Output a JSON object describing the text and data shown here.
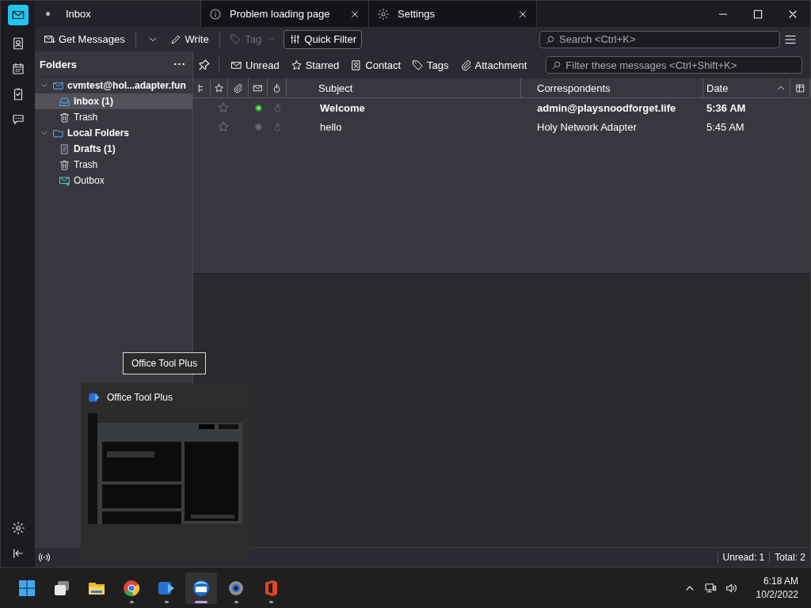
{
  "tabs": [
    {
      "label": "Inbox",
      "kind": "mail",
      "selected": true
    },
    {
      "label": "Problem loading page",
      "kind": "info",
      "selected": false
    },
    {
      "label": "Settings",
      "kind": "gear",
      "selected": false
    }
  ],
  "toolbar": {
    "buttons": [
      {
        "label": "Get Messages",
        "kind": "get",
        "disabled": false
      },
      {
        "label": "Write",
        "kind": "write",
        "disabled": false
      },
      {
        "label": "Tag",
        "kind": "tag",
        "disabled": true
      },
      {
        "label": "Quick Filter",
        "kind": "filter",
        "disabled": false
      }
    ],
    "search": {
      "placeholder": "Search <Ctrl+K>"
    }
  },
  "folders": {
    "title": "Folders",
    "tree": [
      {
        "label": "cvmtest@hol...adapter.fun",
        "kind": "account",
        "expanded": true,
        "selected": false,
        "children": [
          {
            "label": "Inbox (1)",
            "kind": "inbox",
            "selected": true,
            "unread": true
          },
          {
            "label": "Trash",
            "kind": "trash",
            "selected": false,
            "unread": false
          }
        ]
      },
      {
        "label": "Local Folders",
        "kind": "local",
        "expanded": true,
        "selected": false,
        "children": [
          {
            "label": "Drafts (1)",
            "kind": "drafts",
            "selected": false,
            "unread": true
          },
          {
            "label": "Trash",
            "kind": "trash",
            "selected": false,
            "unread": false
          },
          {
            "label": "Outbox",
            "kind": "outbox",
            "selected": false,
            "unread": false
          }
        ]
      }
    ]
  },
  "quick_filter": {
    "buttons": [
      {
        "label": "Unread",
        "kind": "unread",
        "selected": false
      },
      {
        "label": "Starred",
        "kind": "starred",
        "selected": false
      },
      {
        "label": "Contact",
        "kind": "contact",
        "selected": false
      },
      {
        "label": "Tags",
        "kind": "tags",
        "selected": false
      },
      {
        "label": "Attachment",
        "kind": "attachment",
        "selected": false
      }
    ],
    "placeholder": "Filter these messages <Ctrl+Shift+K>"
  },
  "table": {
    "columns": [
      {
        "label": "Subject",
        "sorted": false
      },
      {
        "label": "Correspondents",
        "sorted": false
      },
      {
        "label": "Date",
        "sorted": true
      }
    ],
    "rows": [
      {
        "subject": "Welcome",
        "correspondent": "admin@playsnoodforget.life",
        "date": "5:36 AM",
        "unread": true,
        "starred": false
      },
      {
        "subject": "hello",
        "correspondent": "Holy Network Adapter",
        "date": "5:45 AM",
        "unread": false,
        "starred": false
      }
    ]
  },
  "status_bar": {
    "unread": "Unread: 1",
    "total": "Total: 2"
  },
  "tooltip": "Office Tool Plus",
  "preview_flyout": {
    "title": "Office Tool Plus"
  },
  "taskbar": {
    "apps": [
      {
        "kind": "start",
        "running": false,
        "selected": false
      },
      {
        "kind": "taskview",
        "running": false,
        "selected": false
      },
      {
        "kind": "explorer",
        "running": false,
        "selected": false
      },
      {
        "kind": "browser",
        "running": true,
        "selected": false
      },
      {
        "kind": "tool",
        "running": true,
        "selected": false
      },
      {
        "kind": "mail",
        "running": true,
        "selected": true
      },
      {
        "kind": "settings",
        "running": true,
        "selected": false
      },
      {
        "kind": "office",
        "running": true,
        "selected": false
      }
    ],
    "time": "6:18 AM",
    "date": "10/2/2022"
  }
}
